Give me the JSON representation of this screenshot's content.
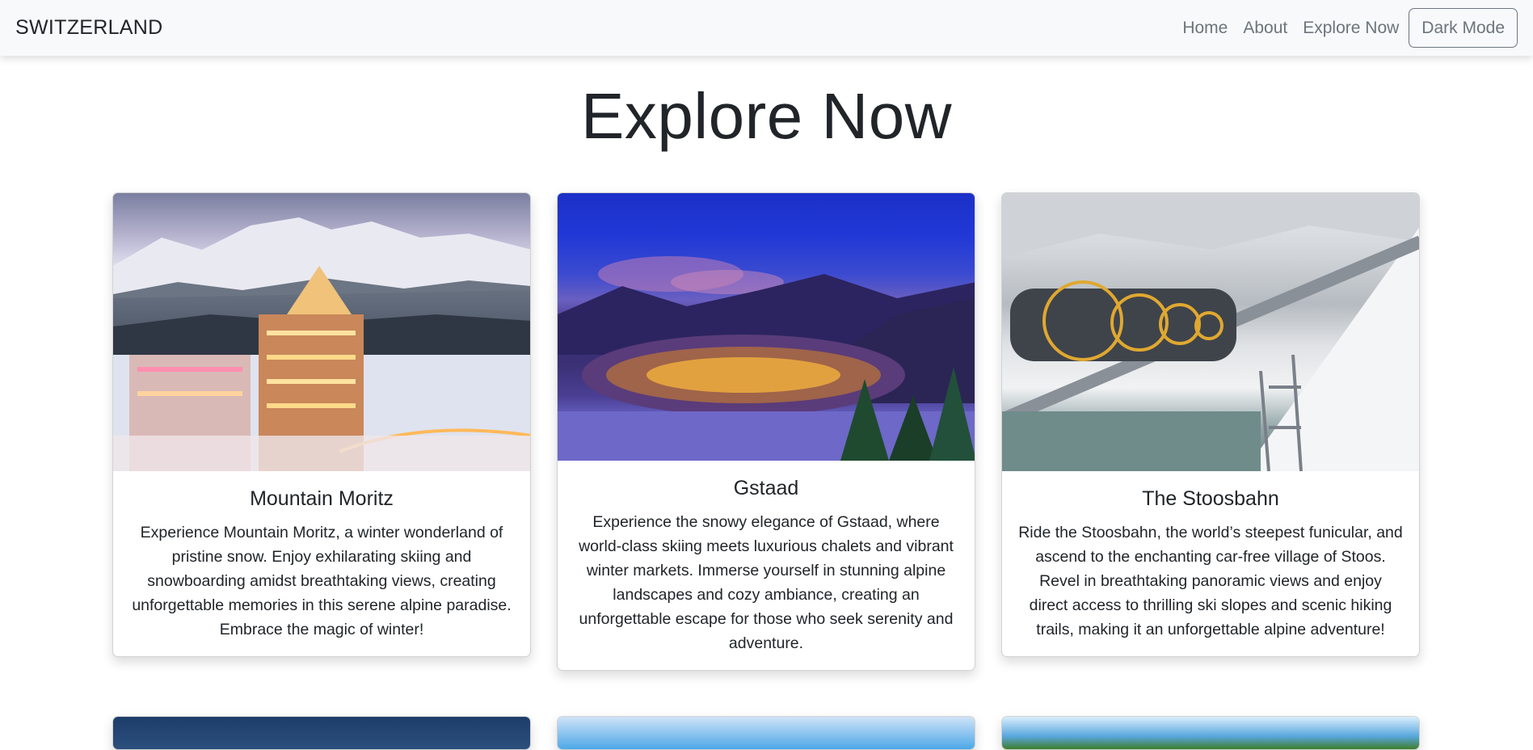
{
  "navbar": {
    "brand": "SWITZERLAND",
    "links": [
      "Home",
      "About",
      "Explore Now"
    ],
    "dark_mode_label": "Dark Mode"
  },
  "page": {
    "title": "Explore Now"
  },
  "cards": [
    {
      "title": "Mountain Moritz",
      "text": "Experience Mountain Moritz, a winter wonderland of pristine snow. Enjoy exhilarating skiing and snowboarding amidst breathtaking views, creating unforgettable memories in this serene alpine paradise. Embrace the magic of winter!"
    },
    {
      "title": "Gstaad",
      "text": "Experience the snowy elegance of Gstaad, where world-class skiing meets luxurious chalets and vibrant winter markets. Immerse yourself in stunning alpine landscapes and cozy ambiance, creating an unforgettable escape for those who seek serenity and adventure."
    },
    {
      "title": "The Stoosbahn",
      "text": "Ride the Stoosbahn, the world’s steepest funicular, and ascend to the enchanting car-free village of Stoos. Revel in breathtaking panoramic views and enjoy direct access to thrilling ski slopes and scenic hiking trails, making it an unforgettable alpine adventure!"
    }
  ]
}
